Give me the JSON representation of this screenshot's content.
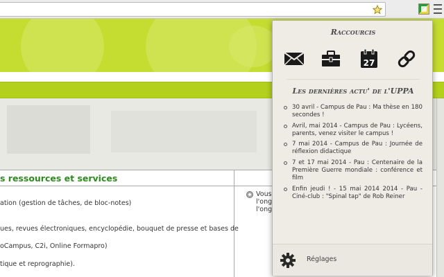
{
  "browser": {
    "icons": [
      "bookmark-star-icon",
      "extension-icon",
      "menu-icon"
    ]
  },
  "page": {
    "section_title": "s ressources et services",
    "left_lines": [
      "ation (gestion de tâches, de bloc-notes)",
      "ues, revues électroniques, encyclopédie, bouquet de presse et bases de",
      "oCampus, C2i, Online Formapro)",
      "tique et reprographie)."
    ],
    "right_lines": [
      "Vous",
      "l'ong",
      "l'ong"
    ]
  },
  "popup": {
    "title": "Raccourcis",
    "shortcuts": [
      {
        "icon": "mail-icon"
      },
      {
        "icon": "briefcase-icon"
      },
      {
        "icon": "calendar-icon",
        "label": "27"
      },
      {
        "icon": "link-icon"
      }
    ],
    "news_title": "Les dernières actu' de l'UPPA",
    "news": [
      "30 avril - Campus de Pau : Ma thèse en 180 secondes !",
      "Avril, mai 2014 - Campus de Pau : Lycéens, parents, venez visiter le campus !",
      "7 mai 2014 - Campus de Pau : Journée de réflexion didactique",
      "7 et 17 mai 2014 - Pau : Centenaire de la Première Guerre mondiale : conférence et film",
      "Enfin jeudi ! - 15 mai 2014 2014 - Pau - Ciné-club : \"Spinal tap\" de Rob Reiner"
    ],
    "settings_label": "Réglages"
  },
  "colors": {
    "banner_green": "#c5dc31",
    "bar_green": "#b3d11c",
    "title_green": "#2e8b1e",
    "popup_bg": "#efece6"
  }
}
